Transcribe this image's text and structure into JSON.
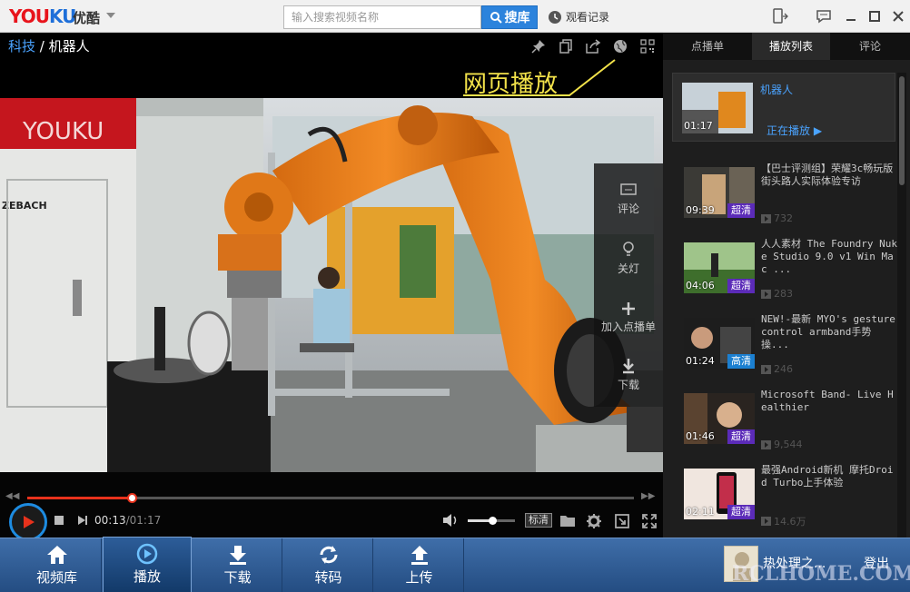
{
  "titlebar": {
    "logo_you": "YOU",
    "logo_ku": "KU",
    "logo_cn": "优酷",
    "search_placeholder": "输入搜索视频名称",
    "search_button": "搜库",
    "history_label": "观看记录"
  },
  "video": {
    "breadcrumb_category": "科技",
    "breadcrumb_separator": "/",
    "breadcrumb_title": "机器人",
    "web_play_label": "网页播放",
    "side_panel": {
      "comment": "评论",
      "lights_off": "关灯",
      "add_to_playlist": "加入点播单",
      "download": "下载"
    },
    "collapse_label": "»",
    "scene_text": "YOUKU",
    "scene_sign": "ZEBACH"
  },
  "controls": {
    "elapsed": "00:13",
    "total": "/01:17",
    "progress": 0.175,
    "volume": 0.52,
    "quality_label": "标清"
  },
  "right_panel": {
    "tabs": [
      {
        "label": "点播单",
        "active": false
      },
      {
        "label": "播放列表",
        "active": true
      },
      {
        "label": "评论",
        "active": false
      }
    ],
    "now_playing_label": "正在播放 ▶",
    "items": [
      {
        "title": "机器人",
        "duration": "01:17",
        "current": true
      },
      {
        "title": "【巴士评测组】荣耀3c畅玩版 街头路人实际体验专访",
        "duration": "09:39",
        "badge": "超清",
        "views": "732"
      },
      {
        "title": "人人素材 The Foundry Nuke Studio 9.0 v1 Win Mac ...",
        "duration": "04:06",
        "badge": "超清",
        "views": "283"
      },
      {
        "title": "NEW!-最新 MYO's gesture control armband手势操...",
        "duration": "01:24",
        "badge": "高清",
        "views": "246"
      },
      {
        "title": "Microsoft Band- Live Healthier",
        "duration": "01:46",
        "badge": "超清",
        "views": "9,544"
      },
      {
        "title": "最强Android新机 摩托Droid Turbo上手体验",
        "duration": "02:11",
        "badge": "超清",
        "views": "14.6万"
      }
    ]
  },
  "bottom_nav": {
    "items": [
      {
        "label": "视频库",
        "icon": "home-icon",
        "active": false
      },
      {
        "label": "播放",
        "icon": "play-circle-icon",
        "active": true
      },
      {
        "label": "下载",
        "icon": "download-icon",
        "active": false
      },
      {
        "label": "转码",
        "icon": "refresh-icon",
        "active": false
      },
      {
        "label": "上传",
        "icon": "upload-icon",
        "active": false
      }
    ],
    "user_name": "热处理之...",
    "login_label": "登出",
    "watermark": "RCLHOME.COM"
  },
  "colors": {
    "accent_blue": "#2c83dc",
    "progress_red": "#e8321c",
    "link_blue": "#4aa3ff",
    "nav_blue": "#244d82",
    "annotation_yellow": "#f2e24a"
  }
}
